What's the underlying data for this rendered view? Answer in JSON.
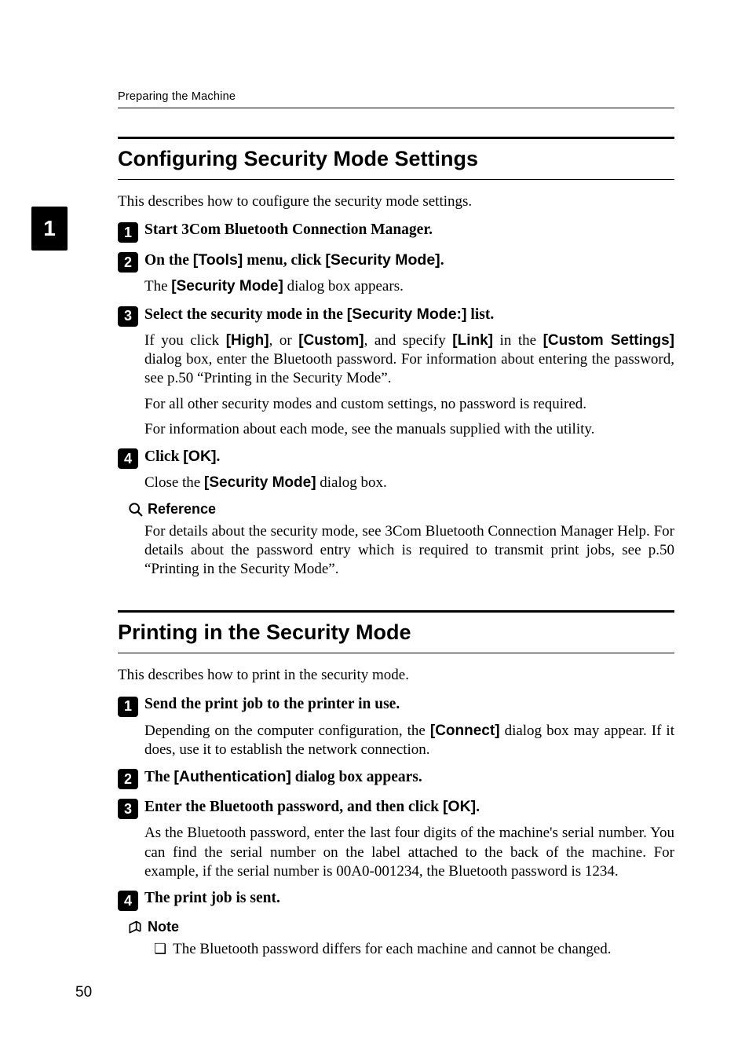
{
  "running_head": "Preparing the Machine",
  "side_tab": "1",
  "page_number": "50",
  "section1": {
    "title": "Configuring Security Mode Settings",
    "intro": "This describes how to coufigure the security mode settings.",
    "steps": {
      "s1": {
        "num": "1",
        "head_pre": "Start 3Com Bluetooth Connection Manager."
      },
      "s2": {
        "num": "2",
        "head_a": "On the ",
        "ui_tools": "[Tools]",
        "head_b": " menu, click ",
        "ui_secmode": "[Security Mode]",
        "head_c": ".",
        "body_a": "The ",
        "body_ui": "[Security Mode]",
        "body_b": " dialog box appears."
      },
      "s3": {
        "num": "3",
        "head_a": "Select the security mode in the ",
        "ui_list": "[Security Mode:]",
        "head_b": " list.",
        "p1_a": "If you click ",
        "ui_high": "[High]",
        "p1_b": ", or ",
        "ui_custom": "[Custom]",
        "p1_c": ", and specify ",
        "ui_link": "[Link]",
        "p1_d": " in the ",
        "ui_custset": "[Custom Settings]",
        "p1_e": " dialog box, enter the Bluetooth password. For information about entering the password, see p.50 “Printing in the Security Mode”.",
        "p2": "For all other security modes and custom settings, no password is required.",
        "p3": "For information about each mode, see the manuals supplied with the utility."
      },
      "s4": {
        "num": "4",
        "head_a": "Click ",
        "ui_ok": "[OK]",
        "head_b": ".",
        "body_a": "Close the ",
        "body_ui": "[Security Mode]",
        "body_b": " dialog box."
      }
    },
    "reference": {
      "label": "Reference",
      "text": "For details about the security mode, see 3Com Bluetooth Connection Manager Help. For details about the password entry which is required to transmit print jobs, see p.50 “Printing in the Security Mode”."
    }
  },
  "section2": {
    "title": "Printing in the Security Mode",
    "intro": "This describes how to print in the security mode.",
    "steps": {
      "s1": {
        "num": "1",
        "head": "Send the print job to the printer in use.",
        "p1_a": "Depending on the computer configuration, the ",
        "ui_connect": "[Connect]",
        "p1_b": " dialog box may appear. If it does, use it to establish the network connection."
      },
      "s2": {
        "num": "2",
        "head_a": "The ",
        "ui_auth": "[Authentication]",
        "head_b": " dialog box appears."
      },
      "s3": {
        "num": "3",
        "head_a": "Enter the Bluetooth password, and then click ",
        "ui_ok": "[OK]",
        "head_b": ".",
        "p1": "As the Bluetooth password, enter the last four digits of the machine's serial number. You can find the serial number on the label attached to the back of the machine. For example, if the serial number is 00A0-001234, the Bluetooth password is 1234."
      },
      "s4": {
        "num": "4",
        "head": "The print job is sent."
      }
    },
    "note": {
      "label": "Note",
      "bullet_mark": "❏",
      "bullet_text": "The Bluetooth password differs for each machine and cannot be changed."
    }
  }
}
